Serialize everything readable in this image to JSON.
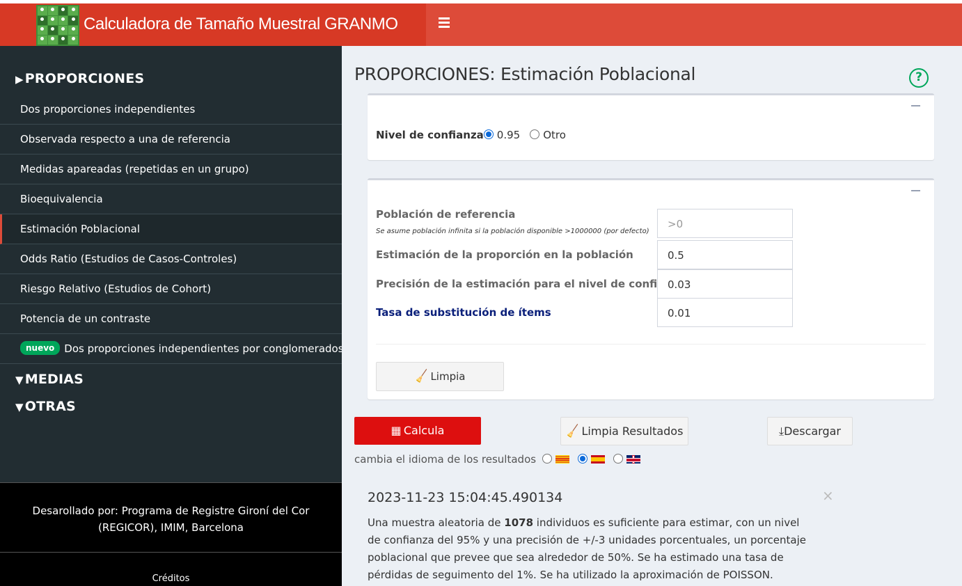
{
  "header": {
    "app_title": "Calculadora de Tamaño Muestral GRANMO",
    "menu_icon": "hamburger-icon",
    "colors": {
      "header_bg": "#dd4b39",
      "brand_bg": "#d73925",
      "sidebar_bg": "#222d32"
    }
  },
  "sidebar": {
    "sections": [
      {
        "label": "PROPORCIONES",
        "icon": "triangle-right-icon"
      },
      {
        "label": "MEDIAS",
        "icon": "triangle-down-icon"
      },
      {
        "label": "OTRAS",
        "icon": "triangle-down-icon"
      }
    ],
    "items": [
      {
        "label": "Dos proporciones independientes"
      },
      {
        "label": "Observada respecto a una de referencia"
      },
      {
        "label": "Medidas apareadas (repetidas en un grupo)"
      },
      {
        "label": "Bioequivalencia"
      },
      {
        "label": "Estimación Poblacional",
        "active": true
      },
      {
        "label": "Odds Ratio (Estudios de Casos-Controles)"
      },
      {
        "label": "Riesgo Relativo (Estudios de Cohort)"
      },
      {
        "label": "Potencia de un contraste"
      },
      {
        "label": "Dos proporciones independientes por conglomerados",
        "badge": "nuevo"
      }
    ],
    "developed_by": "Desarollado por: Programa de Registre Gironí del Cor (REGICOR), IMIM, Barcelona",
    "credits": "Créditos"
  },
  "main": {
    "title": "PROPORCIONES: Estimación Poblacional",
    "help_icon": "question-circle-icon",
    "confidence": {
      "label": "Nivel de confianza",
      "options": [
        "0.95",
        "Otro"
      ],
      "selected": "0.95"
    },
    "fields": [
      {
        "label": "Población de referencia",
        "sublabel": "Se asume población infinita si la población disponible >1000000 (por defecto)",
        "value": "",
        "placeholder": ">0"
      },
      {
        "label": "Estimación de la proporción en la población",
        "value": "0.5"
      },
      {
        "label": "Precisión de la estimación para el nivel de confianza",
        "value": "0.03"
      },
      {
        "label": "Tasa de substitución de ítems",
        "value": "0.01"
      }
    ],
    "buttons": {
      "limpia": "Limpia",
      "calcula": "Calcula",
      "limpia_resultados": "Limpia Resultados",
      "descargar": "Descargar"
    },
    "language": {
      "label": "cambia el idioma de los resultados",
      "options": [
        "catalan-flag",
        "spanish-flag",
        "uk-flag"
      ],
      "selected": "spanish-flag"
    },
    "result": {
      "timestamp": "2023-11-23 15:04:45.490134",
      "text_before": "Una muestra aleatoria de ",
      "sample_size": "1078",
      "text_after": " individuos es suficiente para estimar, con un nivel de confianza del 95% y una precisión de +/-3 unidades porcentuales, un porcentaje poblacional que prevee que sea alrededor de 50%. Se ha estimado una tasa de pérdidas de seguimento del 1%. Se ha utilizado la aproximación de POISSON.",
      "close": "×"
    }
  }
}
